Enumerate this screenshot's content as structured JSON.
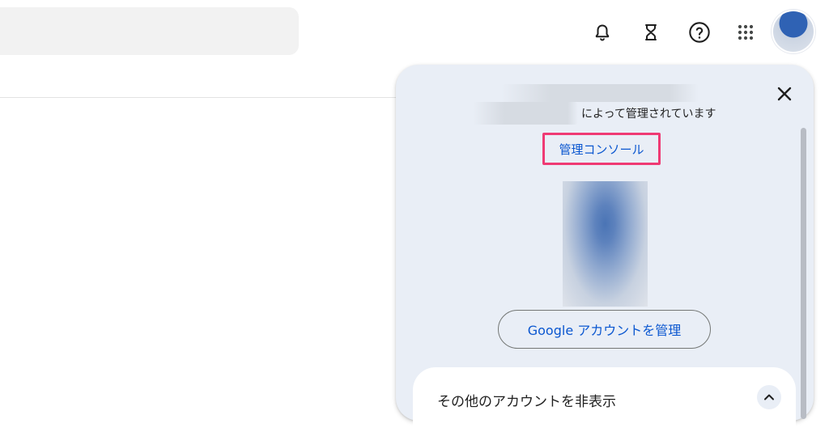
{
  "header": {
    "icons": [
      "bell-icon",
      "hourglass-icon",
      "help-icon",
      "apps-grid-icon"
    ]
  },
  "account_popup": {
    "managed_by_text": "によって管理されています",
    "admin_console_label": "管理コンソール",
    "manage_account_label": "Google アカウントを管理",
    "other_accounts_label": "その他のアカウントを非表示",
    "close_icon": "close-icon",
    "chevron_icon": "chevron-up-icon"
  },
  "colors": {
    "link_blue": "#0b57d0",
    "highlight_pink": "#ef3a74",
    "popup_bg": "#e9eef6"
  }
}
